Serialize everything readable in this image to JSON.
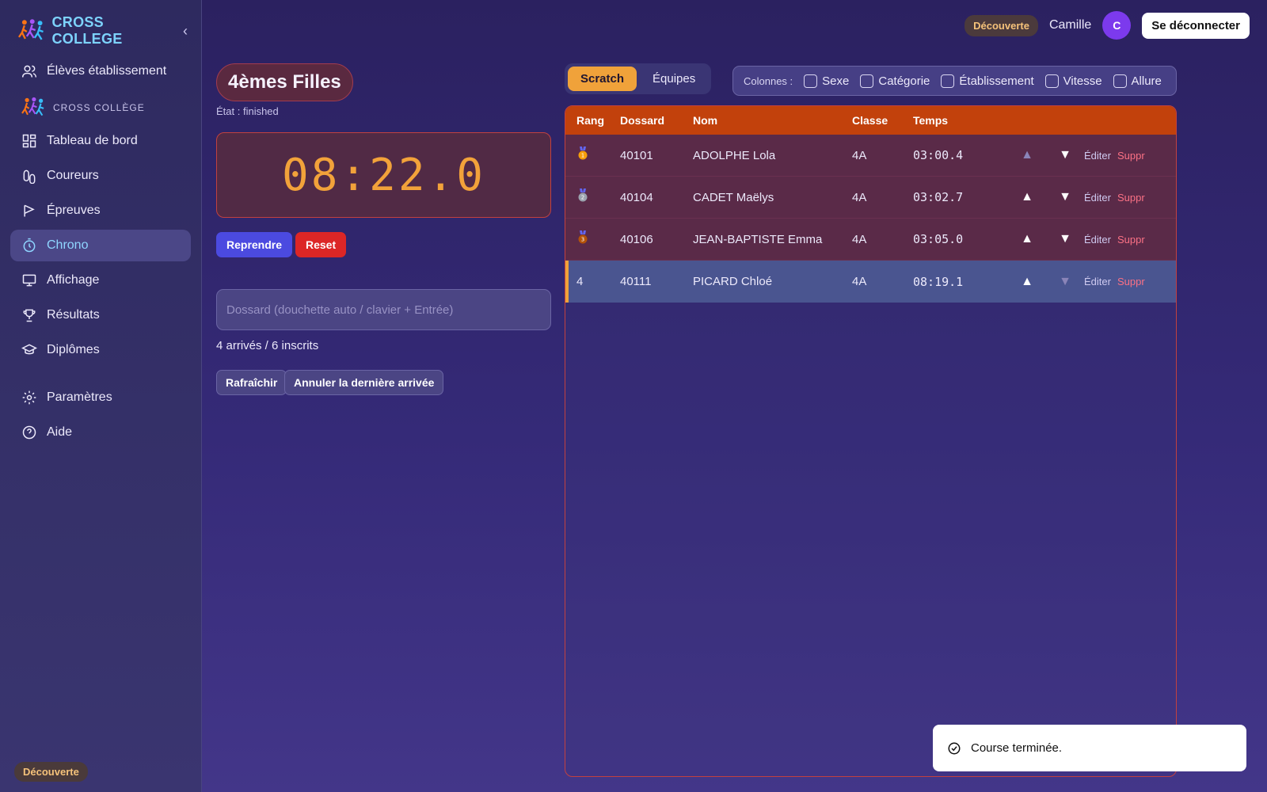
{
  "app": {
    "brand": "CROSS COLLEGE",
    "section_label": "CROSS COLLÈGE"
  },
  "sidebar": {
    "top_item": "Élèves établissement",
    "items": [
      "Tableau de bord",
      "Coureurs",
      "Épreuves",
      "Chrono",
      "Affichage",
      "Résultats",
      "Diplômes"
    ],
    "bottom_items": [
      "Paramètres",
      "Aide"
    ],
    "active": "Chrono",
    "badge": "Découverte"
  },
  "topbar": {
    "badge": "Découverte",
    "user": "Camille",
    "avatar_initial": "C",
    "logout": "Se déconnecter"
  },
  "race": {
    "title": "4èmes Filles",
    "state": "État : finished",
    "chrono": "08:22.0"
  },
  "controls": {
    "resume": "Reprendre",
    "reset": "Reset",
    "bib_placeholder": "Dossard (douchette auto / clavier + Entrée)",
    "counter": "4 arrivés / 6 inscrits",
    "refresh": "Rafraîchir",
    "undo": "Annuler la dernière arrivée"
  },
  "view": {
    "scratch": "Scratch",
    "teams": "Équipes"
  },
  "columns": {
    "label": "Colonnes :",
    "options": [
      "Sexe",
      "Catégorie",
      "Établissement",
      "Vitesse",
      "Allure"
    ]
  },
  "table": {
    "headers": [
      "Rang",
      "Dossard",
      "Nom",
      "Classe",
      "Temps"
    ],
    "rows": [
      {
        "rank": "",
        "medal": "gold",
        "bib": "40101",
        "name": "ADOLPHE Lola",
        "class": "4A",
        "time": "03:00.4",
        "edit": "Éditer",
        "del": "Suppr"
      },
      {
        "rank": "",
        "medal": "silver",
        "bib": "40104",
        "name": "CADET Maëlys",
        "class": "4A",
        "time": "03:02.7",
        "edit": "Éditer",
        "del": "Suppr"
      },
      {
        "rank": "",
        "medal": "bronze",
        "bib": "40106",
        "name": "JEAN-BAPTISTE Emma",
        "class": "4A",
        "time": "03:05.0",
        "edit": "Éditer",
        "del": "Suppr"
      },
      {
        "rank": "4",
        "medal": "",
        "bib": "40111",
        "name": "PICARD Chloé",
        "class": "4A",
        "time": "08:19.1",
        "edit": "Éditer",
        "del": "Suppr"
      }
    ]
  },
  "toast": {
    "message": "Course terminée."
  },
  "colors": {
    "accent": "#f0a23a",
    "chrono": "#f2a23a",
    "header": "#c2410c",
    "danger": "#dc2626",
    "primary": "#4b4ae0"
  }
}
